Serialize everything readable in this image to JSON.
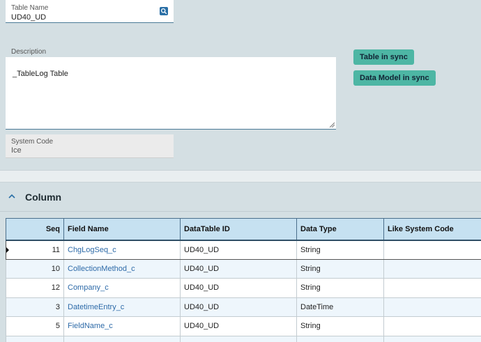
{
  "form": {
    "table_name_label": "Table Name",
    "table_name_value": "UD40_UD",
    "description_label": "Description",
    "description_value": "_TableLog Table",
    "system_code_label": "System Code",
    "system_code_value": "Ice"
  },
  "badges": {
    "table_sync": "Table in sync",
    "data_model_sync": "Data Model in sync"
  },
  "column_section": {
    "title": "Column",
    "headers": [
      "Seq",
      "Field Name",
      "DataTable ID",
      "Data Type",
      "Like System Code"
    ],
    "rows": [
      {
        "seq": "11",
        "field_name": "ChgLogSeq_c",
        "datatable_id": "UD40_UD",
        "data_type": "String",
        "like_system_code": ""
      },
      {
        "seq": "10",
        "field_name": "CollectionMethod_c",
        "datatable_id": "UD40_UD",
        "data_type": "String",
        "like_system_code": ""
      },
      {
        "seq": "12",
        "field_name": "Company_c",
        "datatable_id": "UD40_UD",
        "data_type": "String",
        "like_system_code": ""
      },
      {
        "seq": "3",
        "field_name": "DatetimeEntry_c",
        "datatable_id": "UD40_UD",
        "data_type": "DateTime",
        "like_system_code": ""
      },
      {
        "seq": "5",
        "field_name": "FieldName_c",
        "datatable_id": "UD40_UD",
        "data_type": "String",
        "like_system_code": ""
      },
      {
        "seq": "",
        "field_name": "",
        "datatable_id": "",
        "data_type": "",
        "like_system_code": ""
      }
    ]
  },
  "icons": {
    "search": "search-icon",
    "collapse": "chevron-up-icon"
  },
  "colors": {
    "badge": "#4db6a4",
    "grid_header": "#c6e1f1",
    "link": "#2d6aa8",
    "accent": "#2a6fa6"
  }
}
